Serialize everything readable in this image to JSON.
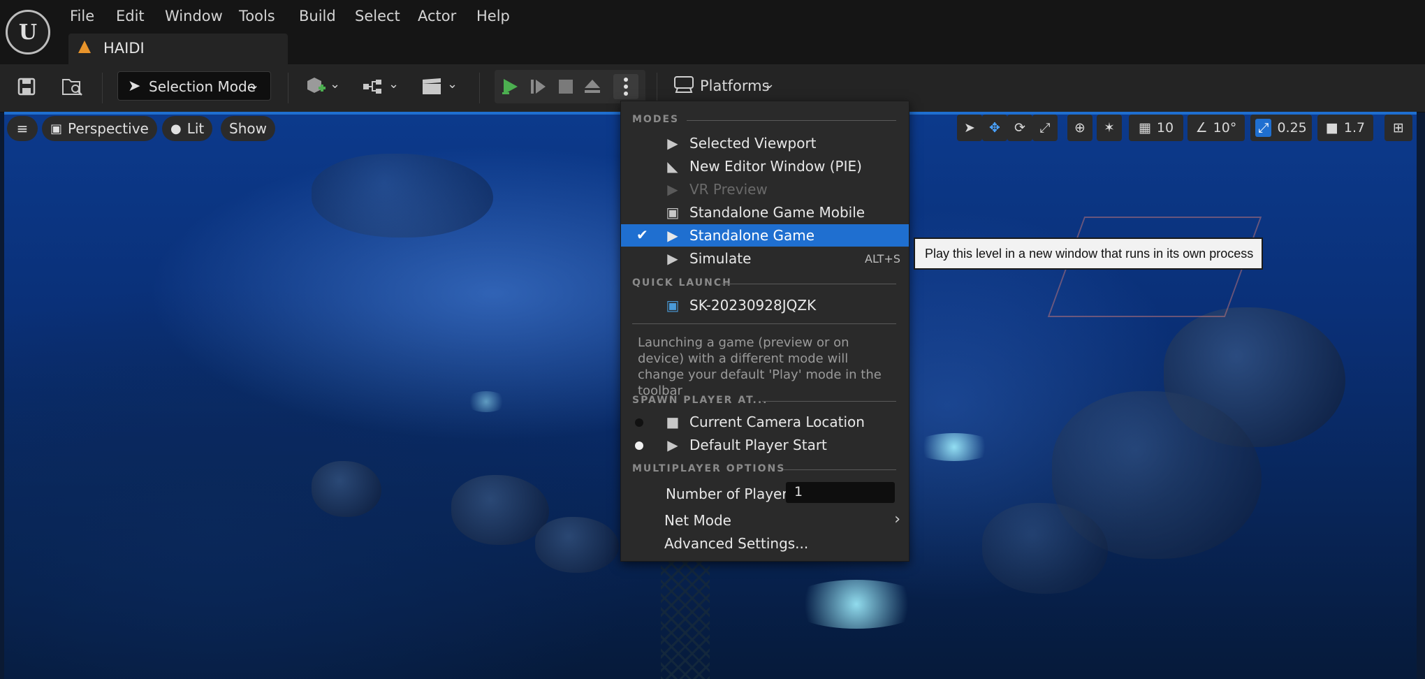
{
  "menu": {
    "items": [
      "File",
      "Edit",
      "Window",
      "Tools",
      "Build",
      "Select",
      "Actor",
      "Help"
    ]
  },
  "tab": {
    "label": "HAIDI"
  },
  "toolbar": {
    "selection_mode_label": "Selection Mode",
    "platforms_label": "Platforms"
  },
  "viewport": {
    "perspective_label": "Perspective",
    "lit_label": "Lit",
    "show_label": "Show",
    "grid_value": "10",
    "rotation_value": "10°",
    "scale_value": "0.25",
    "camera_speed_value": "1.7"
  },
  "play_menu": {
    "modes_header": "MODES",
    "modes": [
      {
        "label": "Selected Viewport",
        "icon": "play-icon",
        "enabled": true
      },
      {
        "label": "New Editor Window (PIE)",
        "icon": "editor-window-icon",
        "enabled": true
      },
      {
        "label": "VR Preview",
        "icon": "vr-icon",
        "enabled": false
      },
      {
        "label": "Standalone Game Mobile",
        "icon": "mobile-icon",
        "enabled": true
      },
      {
        "label": "Standalone Game",
        "icon": "standalone-icon",
        "enabled": true,
        "selected": true
      },
      {
        "label": "Simulate",
        "icon": "simulate-icon",
        "enabled": true,
        "shortcut": "ALT+S"
      }
    ],
    "quick_launch_header": "QUICK LAUNCH",
    "quick_launch_device": "SK-20230928JQZK",
    "description": "Launching a game (preview or on device) with a different mode will change your default 'Play' mode in the toolbar",
    "spawn_header": "SPAWN PLAYER AT...",
    "spawn_options": [
      {
        "label": "Current Camera Location",
        "selected": false
      },
      {
        "label": "Default Player Start",
        "selected": true
      }
    ],
    "multiplayer_header": "MULTIPLAYER OPTIONS",
    "num_players_label": "Number of Players",
    "num_players_value": "1",
    "net_mode_label": "Net Mode",
    "advanced_label": "Advanced Settings..."
  },
  "tooltip": {
    "text": "Play this level in a new window that runs in its own process"
  },
  "colors": {
    "selected_highlight": "#1f6fd0",
    "play_green": "#4caf50",
    "tab_warning": "#e8942b"
  }
}
